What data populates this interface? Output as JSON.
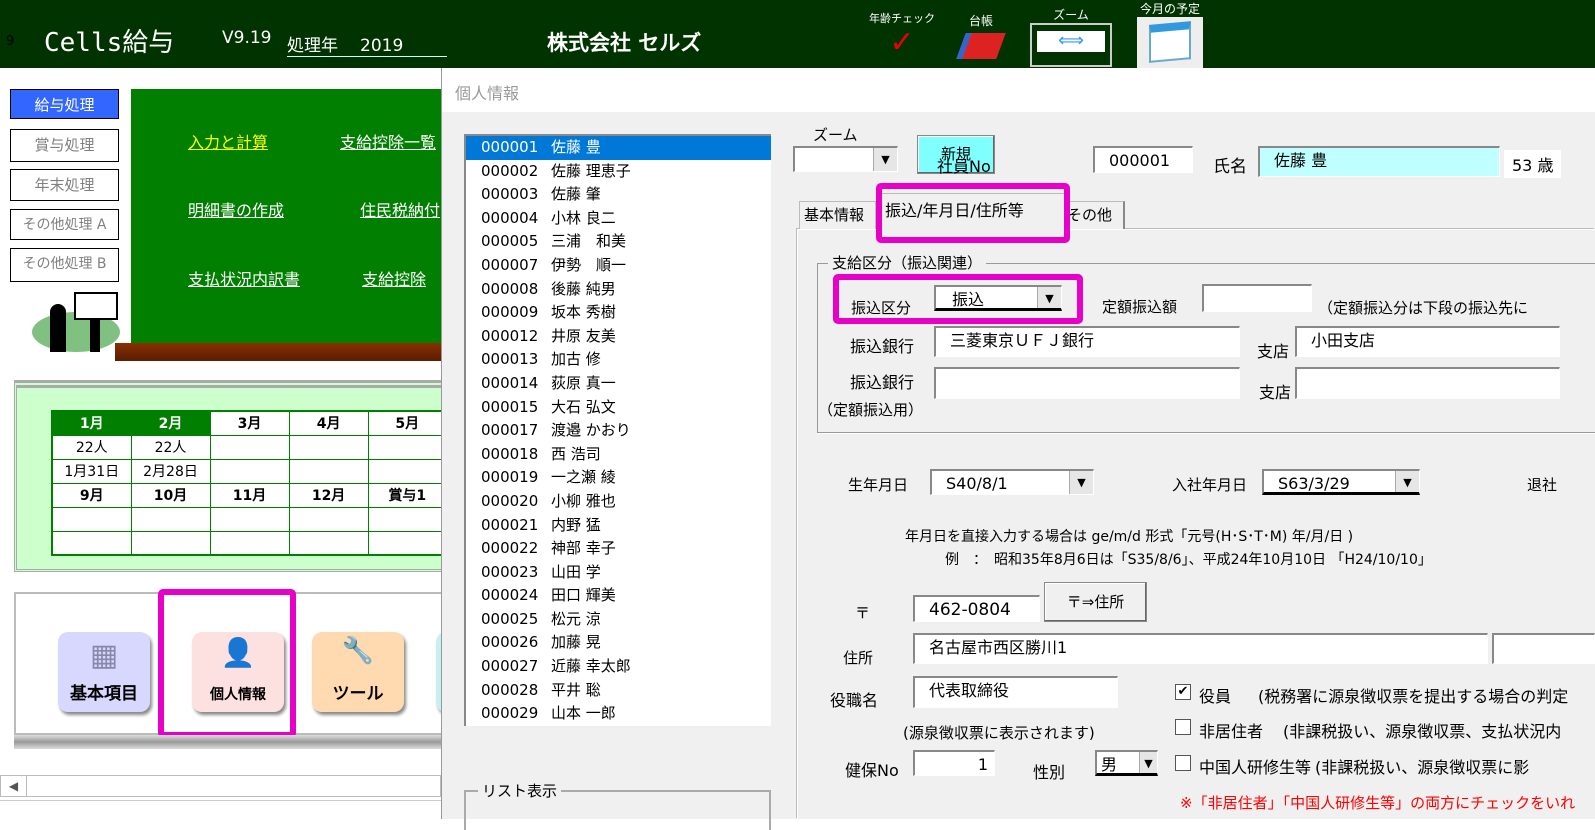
{
  "topbar": {
    "row_num": "9",
    "app_title": "Cells給与",
    "version": "V9.19",
    "year_label": "処理年",
    "year": "2019",
    "company": "株式会社 セルズ",
    "tools": [
      {
        "label": "年齢チェック",
        "icon": "red-check-icon"
      },
      {
        "label": "台帳",
        "icon": "binder-icon"
      },
      {
        "label": "ズーム",
        "icon": "zoom-arrows-icon"
      },
      {
        "label": "今月の予定",
        "icon": "calendar-icon"
      }
    ]
  },
  "sidebar": {
    "items": [
      {
        "label": "給与処理",
        "active": true
      },
      {
        "label": "賞与処理"
      },
      {
        "label": "年末処理"
      },
      {
        "label": "その他処理 A"
      },
      {
        "label": "その他処理 B"
      }
    ]
  },
  "menu": {
    "links": [
      "入力と計算",
      "支給控除一覧",
      "明細書の作成",
      "住民税納付",
      "支払状況内訳書",
      "支給控除"
    ],
    "active_color": "#ffff00"
  },
  "calendar": {
    "row1": [
      "1月",
      "2月",
      "3月",
      "4月",
      "5月"
    ],
    "row2": [
      "22人",
      "22人",
      "",
      "",
      ""
    ],
    "row3": [
      "1月31日",
      "2月28日",
      "",
      "",
      ""
    ],
    "row4": [
      "9月",
      "10月",
      "11月",
      "12月",
      "賞与1"
    ]
  },
  "icons": [
    {
      "label": "基本項目"
    },
    {
      "label": "個人情報"
    },
    {
      "label": "ツール"
    }
  ],
  "dialog": {
    "title": "個人情報",
    "employees": [
      [
        "000001",
        "佐藤 豊"
      ],
      [
        "000002",
        "佐藤 理恵子"
      ],
      [
        "000003",
        "佐藤 肇"
      ],
      [
        "000004",
        "小林 良二"
      ],
      [
        "000005",
        "三浦　和美"
      ],
      [
        "000007",
        "伊勢　順一"
      ],
      [
        "000008",
        "後藤 純男"
      ],
      [
        "000009",
        "坂本 秀樹"
      ],
      [
        "000012",
        "井原 友美"
      ],
      [
        "000013",
        "加古 修"
      ],
      [
        "000014",
        "荻原 真一"
      ],
      [
        "000015",
        "大石 弘文"
      ],
      [
        "000017",
        "渡邉 かおり"
      ],
      [
        "000018",
        "西 浩司"
      ],
      [
        "000019",
        "一之瀬 綾"
      ],
      [
        "000020",
        "小柳 雅也"
      ],
      [
        "000021",
        "内野 猛"
      ],
      [
        "000022",
        "神部 幸子"
      ],
      [
        "000023",
        "山田 学"
      ],
      [
        "000024",
        "田口 輝美"
      ],
      [
        "000025",
        "松元 涼"
      ],
      [
        "000026",
        "加藤 晃"
      ],
      [
        "000027",
        "近藤 幸太郎"
      ],
      [
        "000028",
        "平井 聡"
      ],
      [
        "000029",
        "山本 一郎"
      ]
    ],
    "list_display_label": "リスト表示",
    "zoom_label": "ズーム",
    "zoom_value": "",
    "new_button": "新規",
    "emp_no_label": "社員No",
    "emp_no": "000001",
    "name_label": "氏名",
    "name": "佐藤 豊",
    "age": "53",
    "age_unit": "歳",
    "tabs": [
      {
        "label": "基本情報"
      },
      {
        "label": "振込/年月日/住所等",
        "active": true
      },
      {
        "label": "その他"
      }
    ],
    "transfer": {
      "group_label": "支給区分（振込関連）",
      "kind_label": "振込区分",
      "kind_value": "振込",
      "fixed_label": "定額振込額",
      "fixed_value": "",
      "fixed_note": "（定額振込分は下段の振込先に",
      "bank_label": "振込銀行",
      "bank": "三菱東京ＵＦＪ銀行",
      "branch_label": "支店",
      "branch": "小田支店",
      "bank2_label": "振込銀行",
      "bank2": "",
      "branch2_label": "支店",
      "branch2": "",
      "bank2_note": "（定額振込用）"
    },
    "birth_label": "生年月日",
    "birth": "S40/8/1",
    "join_label": "入社年月日",
    "join": "S63/3/29",
    "leave_label": "退社",
    "date_note1": "年月日を直接入力する場合は ge/m/d  形式「元号(H･S･T･M)  年/月/日 )",
    "date_note2": "例　：　昭和35年8月6日は「S35/8/6」、平成24年10月10日 「H24/10/10」",
    "zip_label": "〒",
    "zip": "462-0804",
    "zip_button": "〒⇒住所",
    "address_label": "住所",
    "address": "名古屋市西区勝川1",
    "address2": "",
    "position_label": "役職名",
    "position": "代表取締役",
    "position_note": "(源泉徴収票に表示されます)",
    "insurance_label": "健保No",
    "insurance": "1",
    "gender_label": "性別",
    "gender": "男",
    "checks": [
      {
        "label": "役員",
        "note": "(税務署に源泉徴収票を提出する場合の判定",
        "checked": true
      },
      {
        "label": "非居住者",
        "note": "(非課税扱い、源泉徴収票、支払状況内",
        "checked": false
      },
      {
        "label": "中国人研修生等",
        "note": "(非課税扱い、源泉徴収票に影",
        "checked": false
      }
    ],
    "warning": "※「非居住者」「中国人研修生等」の両方にチェックをいれ"
  }
}
